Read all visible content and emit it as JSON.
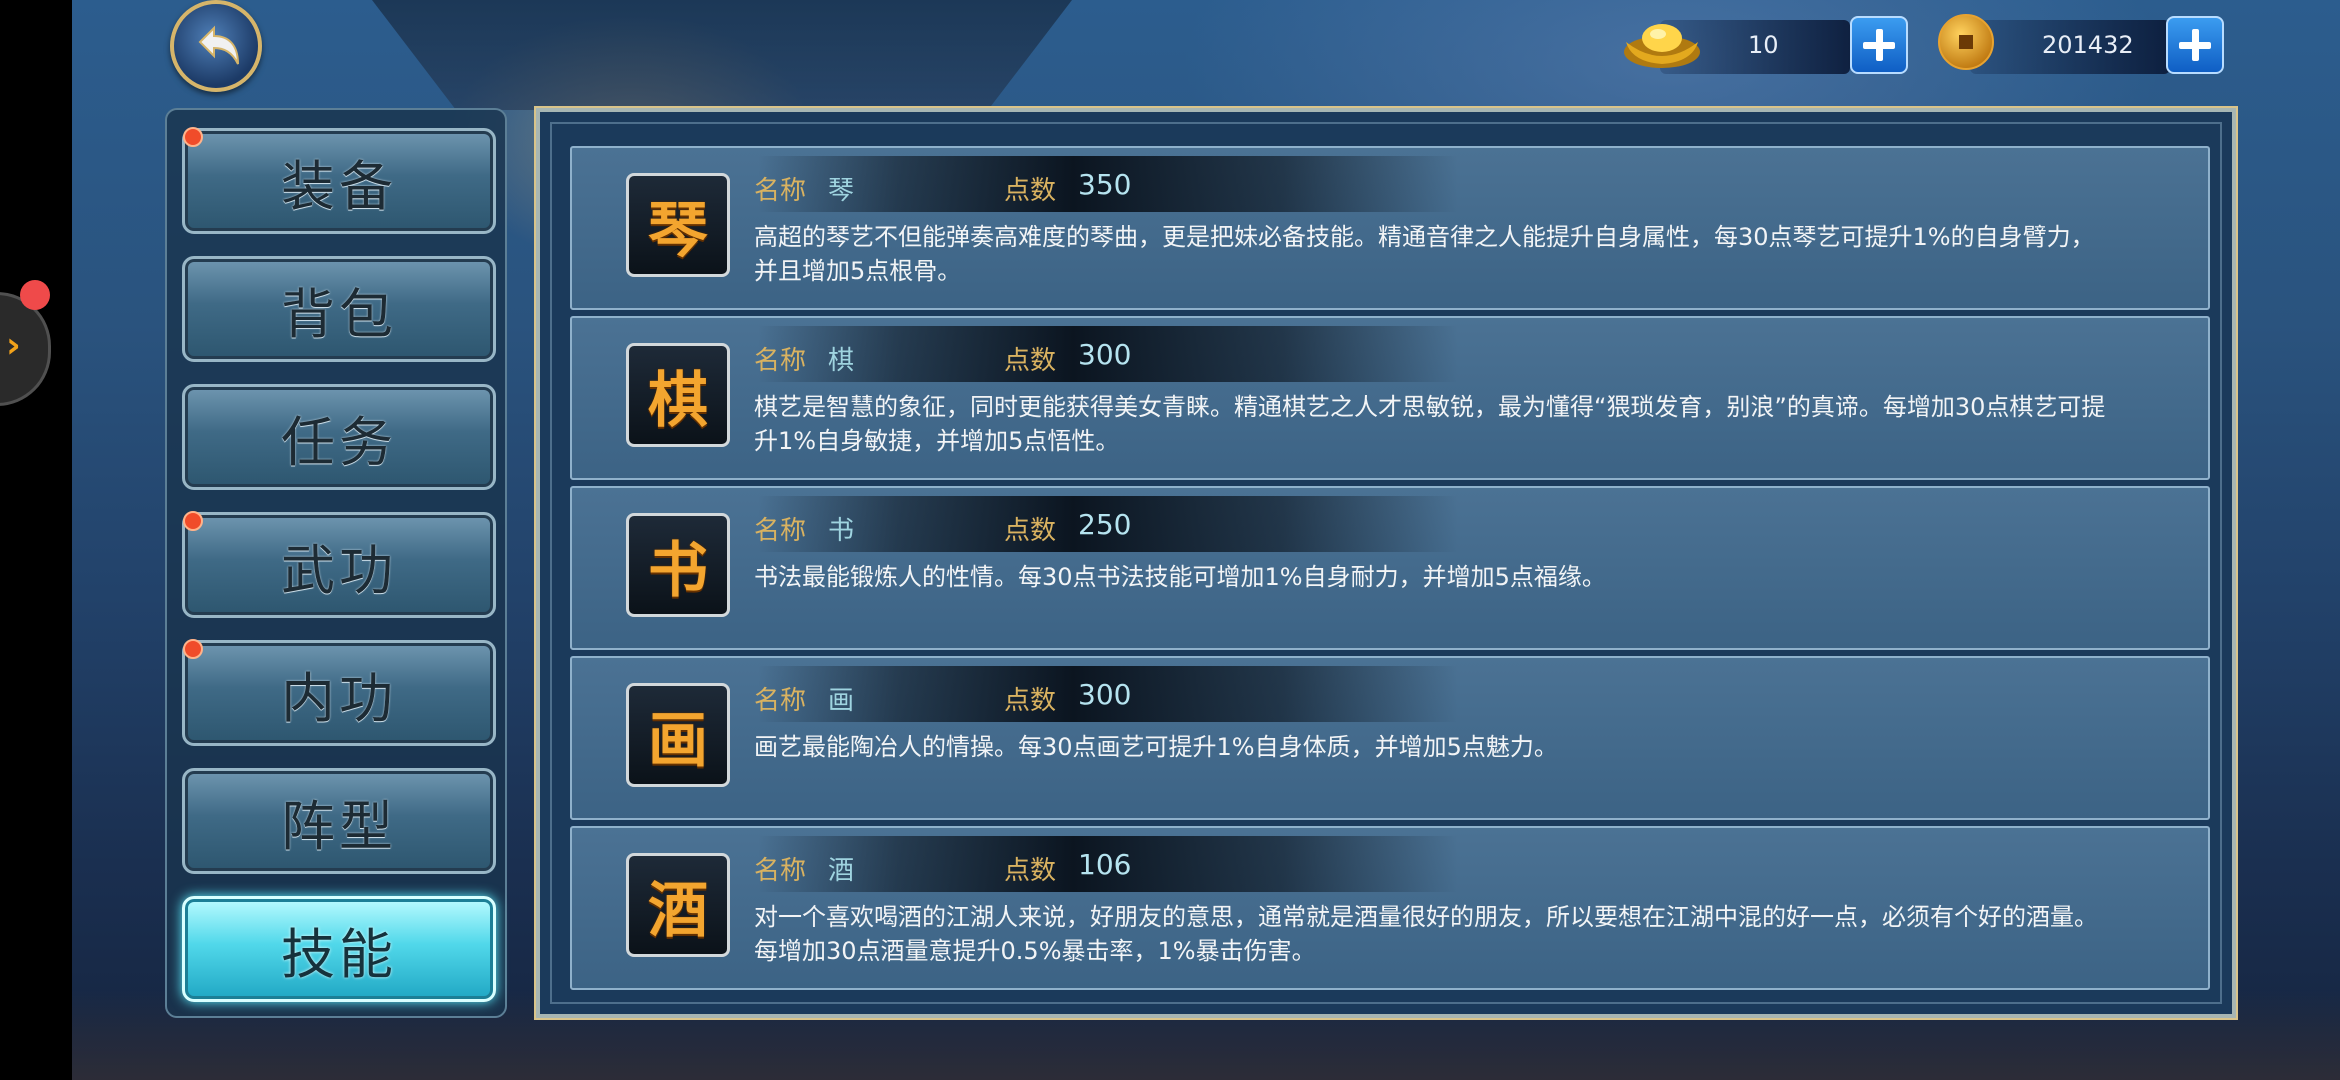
{
  "currency": {
    "ingot": {
      "icon": "gold-ingot-icon",
      "value": "10"
    },
    "coin": {
      "icon": "copper-coin-icon",
      "value": "201432"
    }
  },
  "menu": {
    "items": [
      {
        "label": "装备",
        "badge": true
      },
      {
        "label": "背包",
        "badge": false
      },
      {
        "label": "任务",
        "badge": false
      },
      {
        "label": "武功",
        "badge": true
      },
      {
        "label": "内功",
        "badge": true
      },
      {
        "label": "阵型",
        "badge": false
      },
      {
        "label": "技能",
        "badge": false,
        "active": true
      }
    ]
  },
  "skills": {
    "name_label": "名称",
    "points_label": "点数",
    "rows": [
      {
        "icon_glyph": "琴",
        "name": "琴",
        "points": "350",
        "desc": "高超的琴艺不但能弹奏高难度的琴曲，更是把妹必备技能。精通音律之人能提升自身属性，每30点琴艺可提升1%的自身臂力，并且增加5点根骨。"
      },
      {
        "icon_glyph": "棋",
        "name": "棋",
        "points": "300",
        "desc": "棋艺是智慧的象征，同时更能获得美女青睐。精通棋艺之人才思敏锐，最为懂得“猥琐发育，别浪”的真谛。每增加30点棋艺可提升1%自身敏捷，并增加5点悟性。"
      },
      {
        "icon_glyph": "书",
        "name": "书",
        "points": "250",
        "desc": "书法最能锻炼人的性情。每30点书法技能可增加1%自身耐力，并增加5点福缘。"
      },
      {
        "icon_glyph": "画",
        "name": "画",
        "points": "300",
        "desc": "画艺最能陶冶人的情操。每30点画艺可提升1%自身体质，并增加5点魅力。"
      },
      {
        "icon_glyph": "酒",
        "name": "酒",
        "points": "106",
        "desc": "对一个喜欢喝酒的江湖人来说，好朋友的意思，通常就是酒量很好的朋友，所以要想在江湖中混的好一点，必须有个好的酒量。每增加30点酒量意提升0.5%暴击率，1%暴击伤害。"
      }
    ]
  },
  "colors": {
    "accent_active": "#51d8ea",
    "label_gold": "#d9b260",
    "badge_red": "#f04c2a"
  }
}
